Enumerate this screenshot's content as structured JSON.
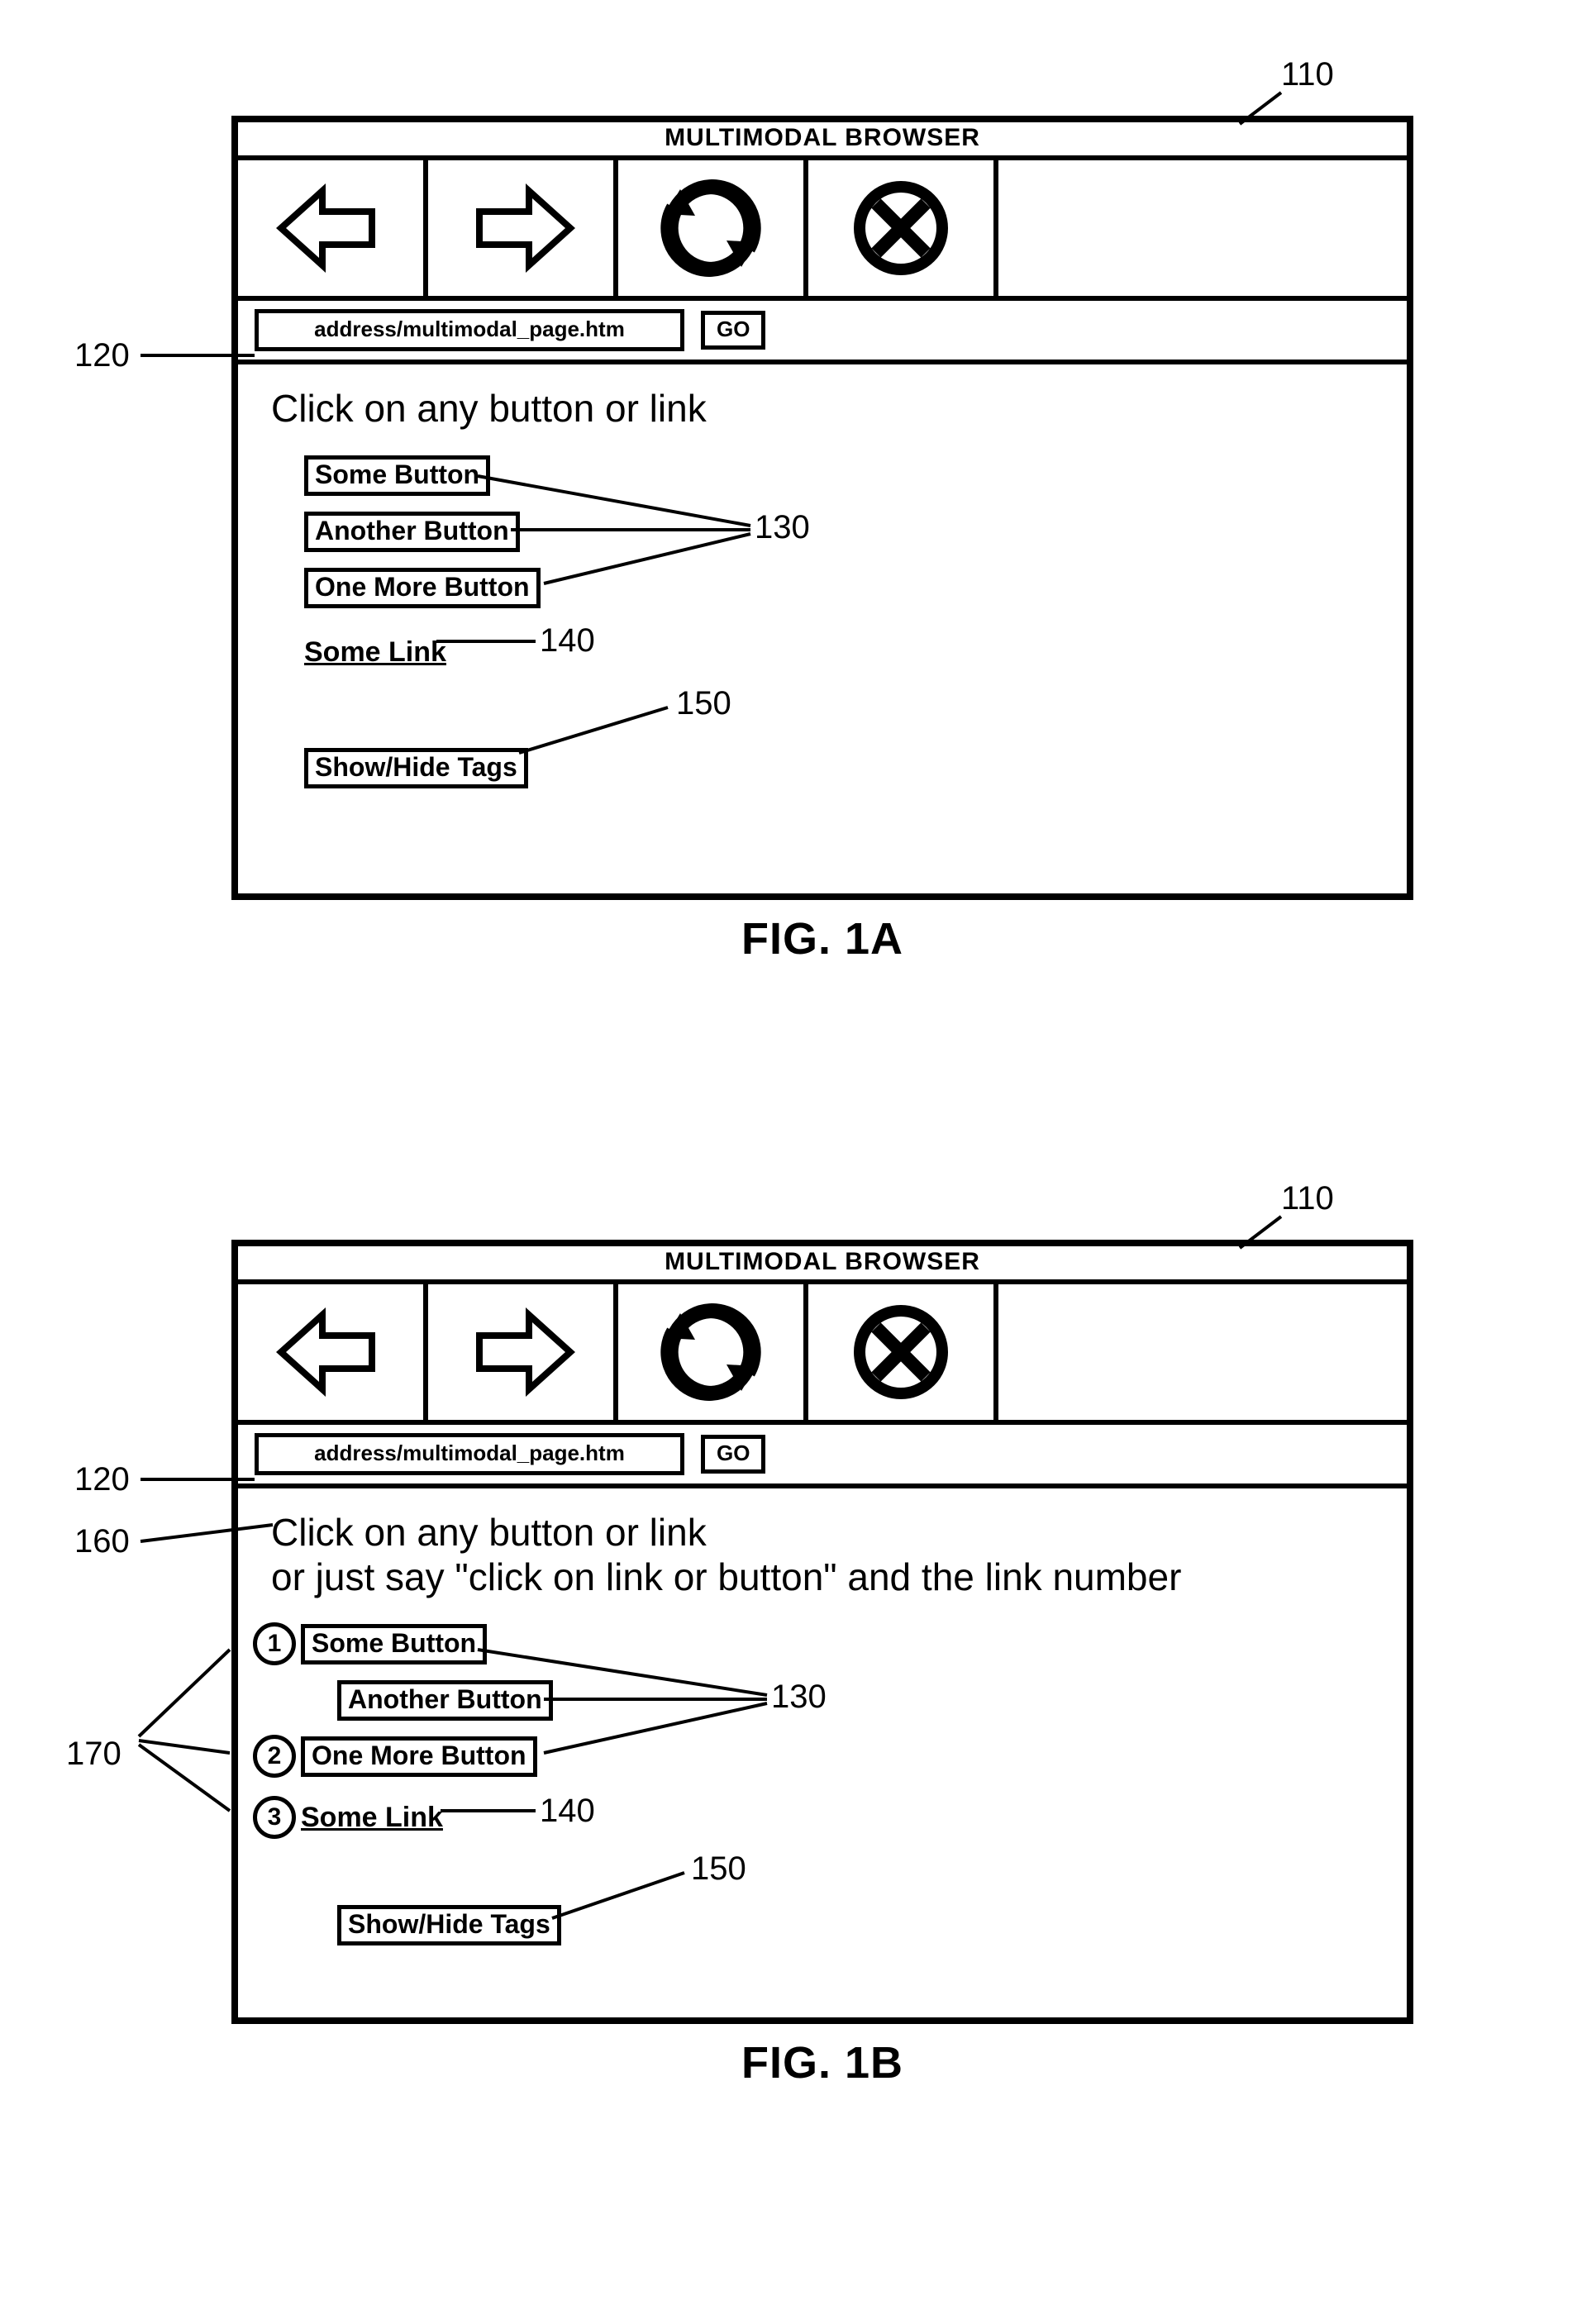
{
  "figA": {
    "title": "MULTIMODAL BROWSER",
    "address": "address/multimodal_page.htm",
    "go": "GO",
    "instruction": "Click on any button or link",
    "buttons": [
      "Some Button",
      "Another Button",
      "One More Button"
    ],
    "link": "Some Link",
    "toggle": "Show/Hide Tags",
    "caption": "FIG. 1A",
    "refs": {
      "window": "110",
      "addr": "120",
      "btns": "130",
      "link": "140",
      "toggle": "150"
    }
  },
  "figB": {
    "title": "MULTIMODAL BROWSER",
    "address": "address/multimodal_page.htm",
    "go": "GO",
    "instr1": "Click on any button or link",
    "instr2": "or just say \"click on link or button\" and the link number",
    "buttons": [
      "Some Button",
      "Another Button",
      "One More Button"
    ],
    "tags": [
      "1",
      "2",
      "3"
    ],
    "link": "Some Link",
    "toggle": "Show/Hide Tags",
    "caption": "FIG. 1B",
    "refs": {
      "window": "110",
      "addr": "120",
      "btns": "130",
      "link": "140",
      "toggle": "150",
      "instr": "160",
      "tags": "170"
    }
  }
}
